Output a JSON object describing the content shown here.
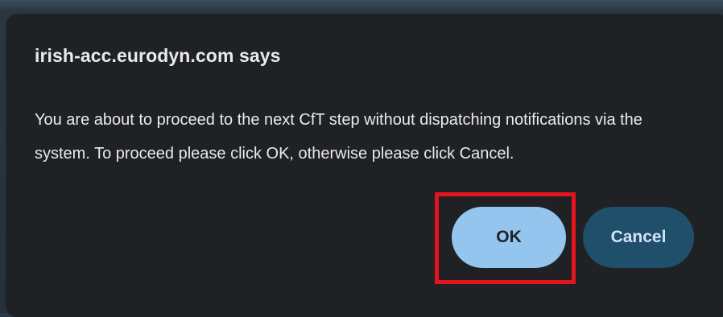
{
  "dialog": {
    "title": "irish-acc.eurodyn.com says",
    "message": "You are about to proceed to the next CfT step without dispatching notifications via the system. To proceed please click OK, otherwise please click Cancel.",
    "ok_label": "OK",
    "cancel_label": "Cancel"
  },
  "colors": {
    "dialog_background": "#202124",
    "ok_button": "#93c5ef",
    "cancel_button": "#1f4f6b",
    "highlight_border": "#e3141b"
  }
}
